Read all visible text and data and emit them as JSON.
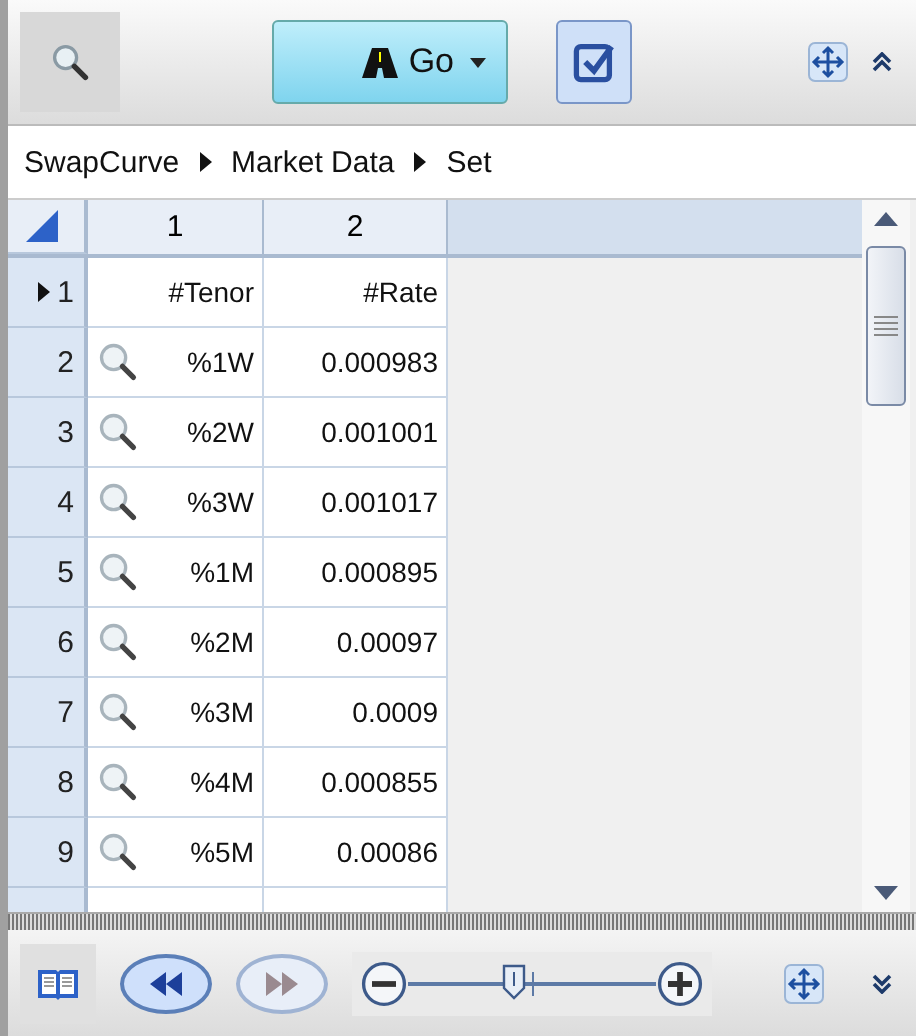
{
  "toolbar": {
    "go_button": {
      "label": "Go",
      "selected": true
    },
    "check_button": {
      "selected": true
    }
  },
  "breadcrumb": [
    "SwapCurve",
    "Market Data",
    "Set"
  ],
  "grid": {
    "columns": [
      "1",
      "2"
    ],
    "rows": [
      {
        "number": "1",
        "current": true,
        "lookup": false,
        "cells": [
          "#Tenor",
          "#Rate"
        ]
      },
      {
        "number": "2",
        "current": false,
        "lookup": true,
        "cells": [
          "%1W",
          "0.000983"
        ]
      },
      {
        "number": "3",
        "current": false,
        "lookup": true,
        "cells": [
          "%2W",
          "0.001001"
        ]
      },
      {
        "number": "4",
        "current": false,
        "lookup": true,
        "cells": [
          "%3W",
          "0.001017"
        ]
      },
      {
        "number": "5",
        "current": false,
        "lookup": true,
        "cells": [
          "%1M",
          "0.000895"
        ]
      },
      {
        "number": "6",
        "current": false,
        "lookup": true,
        "cells": [
          "%2M",
          "0.00097"
        ]
      },
      {
        "number": "7",
        "current": false,
        "lookup": true,
        "cells": [
          "%3M",
          "0.0009"
        ]
      },
      {
        "number": "8",
        "current": false,
        "lookup": true,
        "cells": [
          "%4M",
          "0.000855"
        ]
      },
      {
        "number": "9",
        "current": false,
        "lookup": true,
        "cells": [
          "%5M",
          "0.00086"
        ]
      }
    ]
  },
  "bottom_bar": {
    "back_button": {
      "disabled": false
    },
    "forward_button": {
      "disabled": true
    },
    "zoom_slider": {
      "level": 0.43
    }
  }
}
